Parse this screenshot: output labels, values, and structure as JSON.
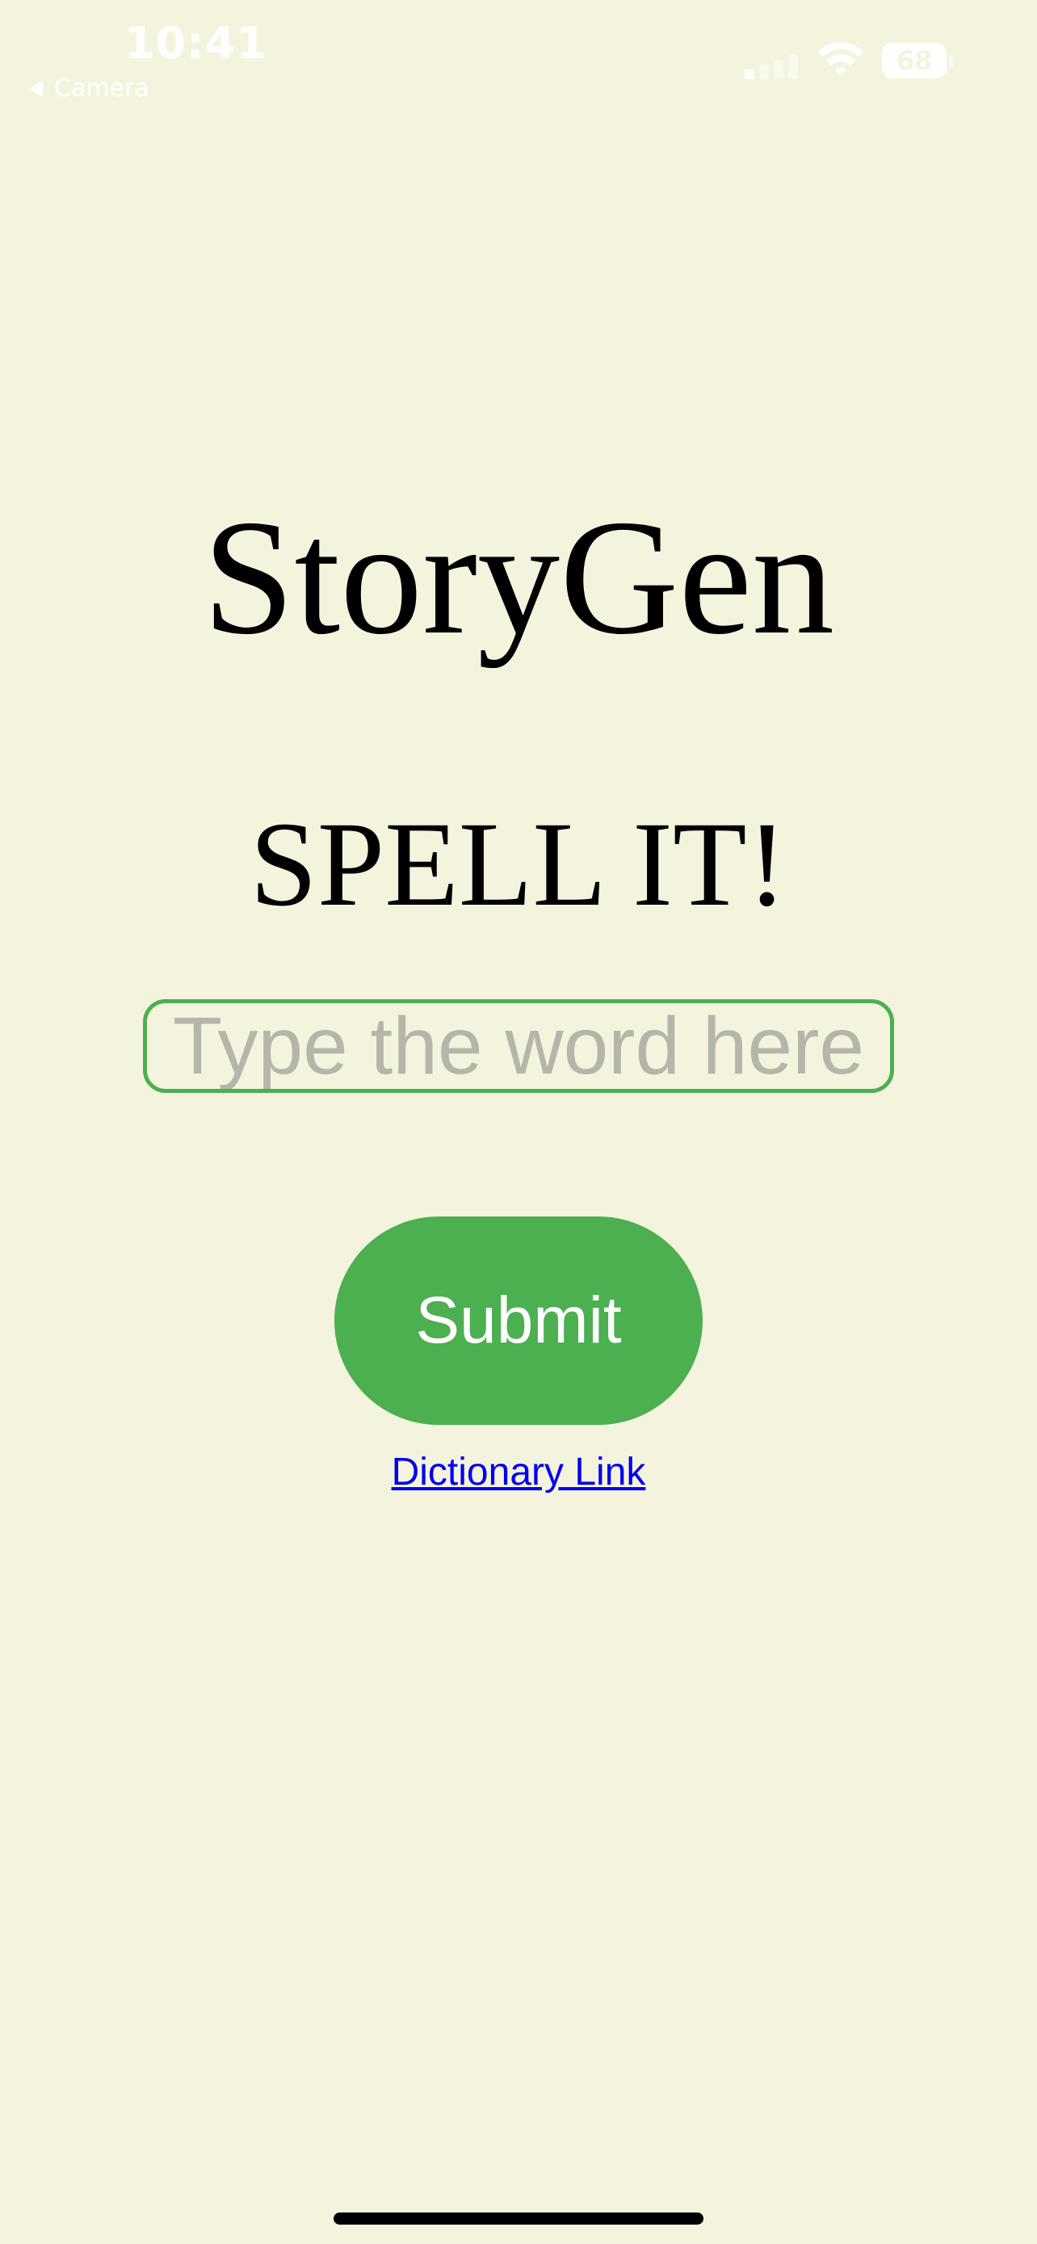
{
  "status_bar": {
    "time": "10:41",
    "back_app": "Camera",
    "battery": "68",
    "icons": [
      "back-arrow-icon",
      "cellular-signal-icon",
      "wifi-icon",
      "battery-icon"
    ]
  },
  "main": {
    "title": "StoryGen",
    "prompt": "SPELL IT!",
    "word_input": {
      "value": "",
      "placeholder": "Type the word here"
    },
    "submit_label": "Submit",
    "dictionary_link_label": "Dictionary Link"
  },
  "colors": {
    "background": "#f4f4de",
    "accent_green": "#4caf50",
    "link_blue": "#0000ee",
    "placeholder_gray": "#b4b6aa"
  }
}
